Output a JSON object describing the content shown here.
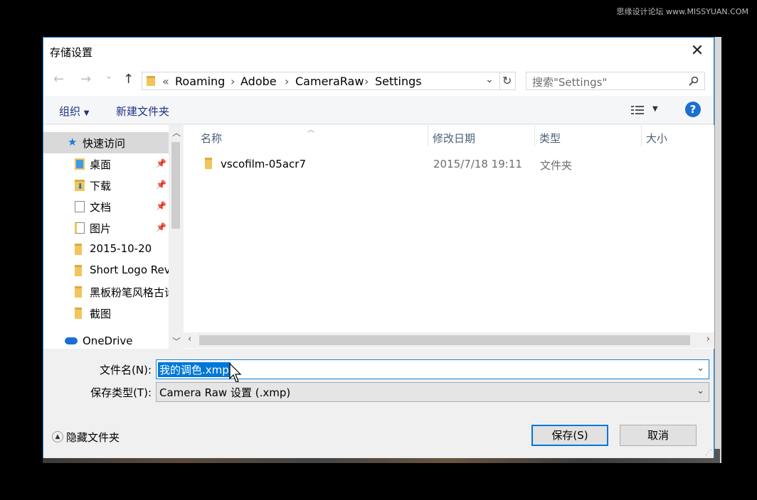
{
  "watermark": "思缘设计论坛 www.MISSYUAN.COM",
  "dialog": {
    "title": "存储设置",
    "close_icon": "close-icon"
  },
  "nav": {
    "back": "←",
    "forward": "→",
    "recent": "⌄",
    "up": "↑",
    "address": {
      "overflow": "«",
      "crumbs": [
        "Roaming",
        "Adobe",
        "CameraRaw",
        "Settings"
      ],
      "separator": "›"
    },
    "refresh": "↻",
    "search_placeholder": "搜索\"Settings\""
  },
  "toolbar": {
    "organize": "组织",
    "new_folder": "新建文件夹",
    "help": "?"
  },
  "sidebar": {
    "items": [
      {
        "label": "快速访问",
        "icon": "star-icon",
        "pinned": false
      },
      {
        "label": "桌面",
        "icon": "desktop-icon",
        "pinned": true
      },
      {
        "label": "下载",
        "icon": "download-icon",
        "pinned": true
      },
      {
        "label": "文档",
        "icon": "document-icon",
        "pinned": true
      },
      {
        "label": "图片",
        "icon": "picture-icon",
        "pinned": true
      },
      {
        "label": "2015-10-20",
        "icon": "folder-icon",
        "pinned": false
      },
      {
        "label": "Short Logo Rev",
        "icon": "folder-icon",
        "pinned": false
      },
      {
        "label": "黑板粉笔风格古诗",
        "icon": "folder-icon",
        "pinned": false
      },
      {
        "label": "截图",
        "icon": "folder-icon",
        "pinned": false
      },
      {
        "label": "OneDrive",
        "icon": "cloud-icon",
        "pinned": false
      }
    ]
  },
  "files": {
    "columns": [
      "名称",
      "修改日期",
      "类型",
      "大小"
    ],
    "rows": [
      {
        "name": "vscofilm-05acr7",
        "date": "2015/7/18 19:11",
        "type": "文件夹",
        "size": ""
      }
    ]
  },
  "form": {
    "filename_label": "文件名(N):",
    "filename_value": "我的调色.xmp",
    "filetype_label": "保存类型(T):",
    "filetype_value": "Camera Raw 设置 (.xmp)"
  },
  "footer": {
    "hide_folders": "隐藏文件夹",
    "save": "保存(S)",
    "cancel": "取消"
  },
  "colors": {
    "accent": "#1883d7",
    "selection": "#0078d7",
    "folder": "#f2c55c"
  }
}
